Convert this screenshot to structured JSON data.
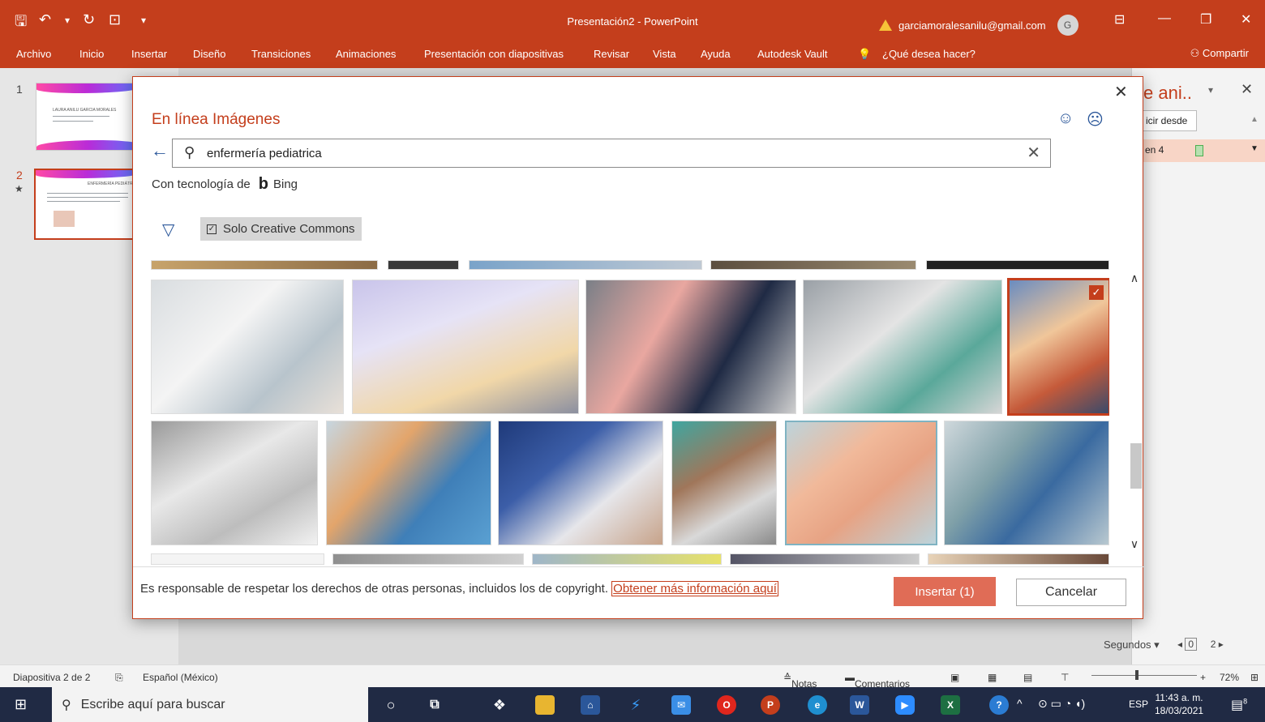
{
  "titlebar": {
    "title": "Presentación2 - PowerPoint",
    "account": "garciamoralesanilu@gmail.com",
    "avatar": "G",
    "quick_access": [
      "save-icon",
      "undo-icon",
      "redo-icon",
      "start-from-beginning-icon",
      "customize-icon"
    ]
  },
  "ribbon": {
    "tabs": [
      "Archivo",
      "Inicio",
      "Insertar",
      "Diseño",
      "Transiciones",
      "Animaciones",
      "Presentación con diapositivas",
      "Revisar",
      "Vista",
      "Ayuda",
      "Autodesk Vault"
    ],
    "tell_me": "¿Qué desea hacer?",
    "share": "Compartir"
  },
  "thumbnails": [
    {
      "num": "1",
      "text": "LAURA ANILU GARCIA MORALES"
    },
    {
      "num": "2",
      "text": "ENFERMERÍA PEDIÁTRICA"
    }
  ],
  "right_pane": {
    "title": "e ani..",
    "field": "icir desde",
    "row": "en 4",
    "seconds_label": "Segundos",
    "spin_value": "0",
    "spin_value2": "2"
  },
  "dialog": {
    "title": "En línea Imágenes",
    "search_value": "enfermería pediatrica",
    "powered_by": "Con tecnología de",
    "bing": "Bing",
    "filter_label": "Solo Creative Commons",
    "notice": "Es responsable de respetar los derechos de otras personas, incluidos los de copyright.",
    "notice_link": "Obtener más información aquí",
    "insert_label": "Insertar (1)",
    "cancel_label": "Cancelar"
  },
  "statusbar": {
    "slide": "Diapositiva 2 de 2",
    "language": "Español (México)",
    "notes": "Notas",
    "comments": "Comentarios",
    "zoom": "72%"
  },
  "taskbar": {
    "search_placeholder": "Escribe aquí para buscar",
    "language": "ESP",
    "time": "11:43 a. m.",
    "date": "18/03/2021",
    "notifications": "8"
  }
}
